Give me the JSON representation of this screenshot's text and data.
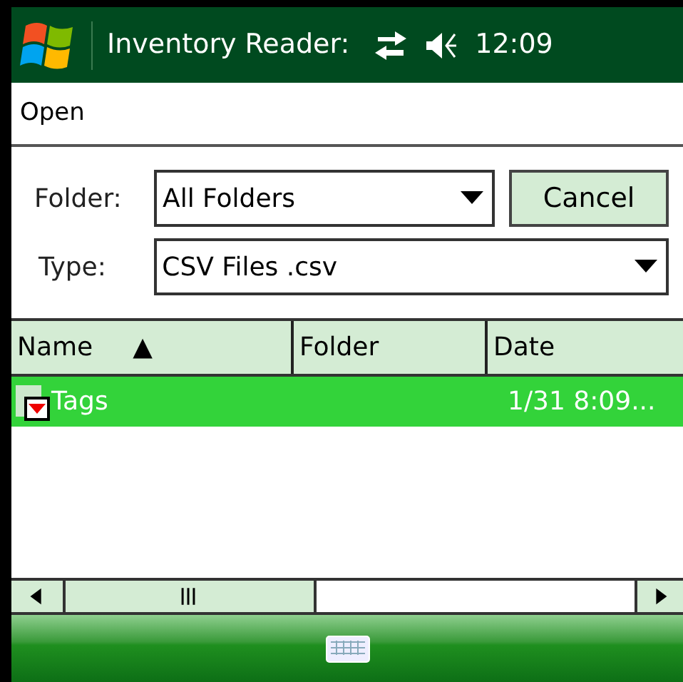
{
  "status_bar": {
    "title": "Inventory Reader:",
    "time": "12:09"
  },
  "menu": {
    "title": "Open"
  },
  "folder": {
    "label": "Folder:",
    "value": "All Folders"
  },
  "cancel_button": "Cancel",
  "type": {
    "label": "Type:",
    "value": "CSV Files .csv"
  },
  "table": {
    "columns": [
      {
        "label": "Name",
        "sort": "▲"
      },
      {
        "label": "Folder"
      },
      {
        "label": "Date"
      }
    ],
    "rows": [
      {
        "name": "Tags",
        "date": "1/31 8:09...",
        "selected": true
      }
    ]
  }
}
